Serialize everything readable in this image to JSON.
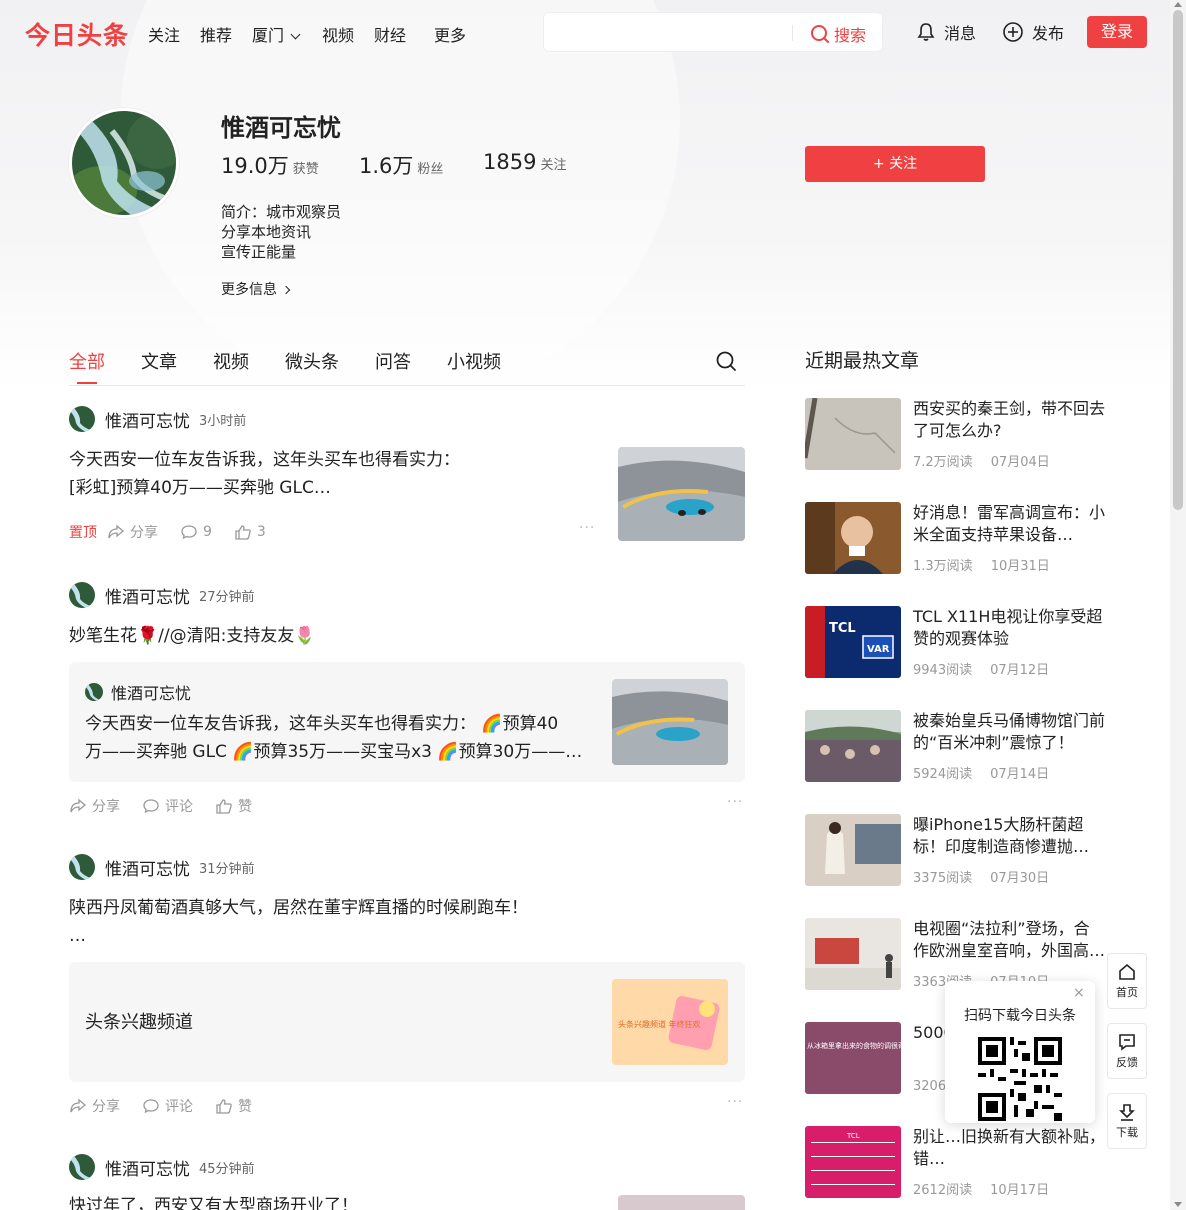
{
  "nav": {
    "logo": "今日头条",
    "items": [
      "关注",
      "推荐",
      "厦门",
      "视频",
      "财经",
      "更多"
    ],
    "search_placeholder": "",
    "search_label": "搜索",
    "messages": "消息",
    "publish": "发布",
    "login": "登录"
  },
  "profile": {
    "name": "惟酒可忘忧",
    "likes_num": "19.0万",
    "likes_label": "获赞",
    "fans_num": "1.6万",
    "fans_label": "粉丝",
    "following_num": "1859",
    "following_label": "关注",
    "bio_lines": [
      "简介：城市观察员",
      "分享本地资讯",
      "宣传正能量"
    ],
    "more_info": "更多信息",
    "follow_button": "+ 关注"
  },
  "tabs": [
    "全部",
    "文章",
    "视频",
    "微头条",
    "问答",
    "小视频"
  ],
  "feed": [
    {
      "author": "惟酒可忘忧",
      "time": "3小时前",
      "text_line1": "今天西安一位车友告诉我，这年头买车也得看实力：",
      "text_line2": "[彩虹]预算40万——买奔驰 GLC…",
      "pinned": "置顶",
      "share": "分享",
      "comments": "9",
      "likes": "3",
      "more": "···"
    },
    {
      "author": "惟酒可忘忧",
      "time": "27分钟前",
      "text": "妙笔生花🌹//@清阳:支持友友🌷",
      "quote_author": "惟酒可忘忧",
      "quote_line1": "今天西安一位车友告诉我，这年头买车也得看实力： 🌈预算40",
      "quote_line2": "万——买奔驰 GLC 🌈预算35万——买宝马x3 🌈预算30万——…",
      "share": "分享",
      "comment": "评论",
      "like": "赞",
      "more": "···"
    },
    {
      "author": "惟酒可忘忧",
      "time": "31分钟前",
      "text_line1": "陕西丹凤葡萄酒真够大气，居然在董宇辉直播的时候刷跑车！",
      "text_line2": "…",
      "card_title": "头条兴趣频道",
      "share": "分享",
      "comment": "评论",
      "like": "赞",
      "more": "···"
    },
    {
      "author": "惟酒可忘忧",
      "time": "45分钟前",
      "text": "快过年了，西安又有大型商场开业了！"
    }
  ],
  "sidebar": {
    "title": "近期最热文章",
    "items": [
      {
        "title": "西安买的秦王剑，带不回去了可怎么办?",
        "reads": "7.2万阅读",
        "date": "07月04日"
      },
      {
        "title": "好消息！雷军高调宣布：小米全面支持苹果设备…",
        "reads": "1.3万阅读",
        "date": "10月31日"
      },
      {
        "title": "TCL X11H电视让你享受超赞的观赛体验",
        "reads": "9943阅读",
        "date": "07月12日"
      },
      {
        "title": "被秦始皇兵马俑博物馆门前的“百米冲刺”震惊了！",
        "reads": "5924阅读",
        "date": "07月14日"
      },
      {
        "title": "曝iPhone15大肠杆菌超标！印度制造商惨遭抛…",
        "reads": "3375阅读",
        "date": "07月30日"
      },
      {
        "title": "电视圈“法拉利”登场，合作欧洲皇室音响，外国高…",
        "reads": "3363阅读",
        "date": "07月10日"
      },
      {
        "title": "5000…箱?",
        "reads": "3206阅读",
        "date": ""
      },
      {
        "title": "别让…旧换新有大额补贴，错…",
        "reads": "2612阅读",
        "date": "10月17日"
      }
    ]
  },
  "thumb_text": {
    "ice_box": "从冰箱里拿出来的食物的调很奇怪",
    "tcl_top": "TCL",
    "tcl_var": "VAR",
    "fun_channel": "头条兴趣频道 年终狂欢",
    "list_tcl": "TCL"
  },
  "qr": {
    "title": "扫码下载今日头条",
    "close": "×"
  },
  "float": {
    "home": "首页",
    "feedback": "反馈",
    "download": "下载"
  },
  "colors": {
    "brand": "#f04142",
    "text": "#222222",
    "muted": "#999999"
  }
}
